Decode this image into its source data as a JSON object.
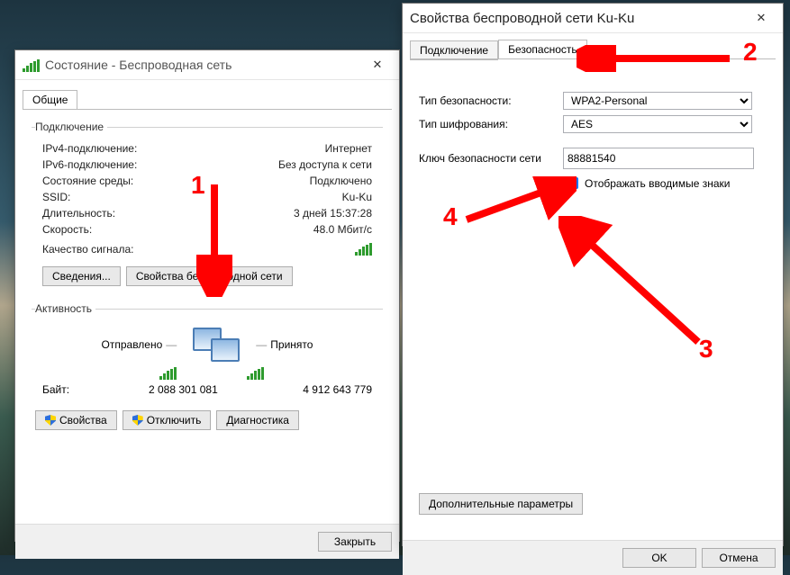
{
  "leftWindow": {
    "title": "Состояние - Беспроводная сеть",
    "tabs": {
      "general": "Общие"
    },
    "connection": {
      "legend": "Подключение",
      "ipv4_label": "IPv4-подключение:",
      "ipv4_value": "Интернет",
      "ipv6_label": "IPv6-подключение:",
      "ipv6_value": "Без доступа к сети",
      "media_label": "Состояние среды:",
      "media_value": "Подключено",
      "ssid_label": "SSID:",
      "ssid_value": "Ku-Ku",
      "duration_label": "Длительность:",
      "duration_value": "3 дней 15:37:28",
      "speed_label": "Скорость:",
      "speed_value": "48.0 Мбит/с",
      "signal_label": "Качество сигнала:",
      "details_btn": "Сведения...",
      "wprops_btn": "Свойства беспроводной сети"
    },
    "activity": {
      "legend": "Активность",
      "sent": "Отправлено",
      "received": "Принято",
      "bytes_label": "Байт:",
      "bytes_sent": "2 088 301 081",
      "bytes_received": "4 912 643 779"
    },
    "buttons": {
      "properties": "Свойства",
      "disable": "Отключить",
      "diagnose": "Диагностика",
      "close": "Закрыть"
    }
  },
  "rightWindow": {
    "title": "Свойства беспроводной сети Ku-Ku",
    "tabs": {
      "connection": "Подключение",
      "security": "Безопасность"
    },
    "sectype_label": "Тип безопасности:",
    "sectype_value": "WPA2-Personal",
    "enctype_label": "Тип шифрования:",
    "enctype_value": "AES",
    "key_label": "Ключ безопасности сети",
    "key_value": "88881540",
    "showchars_label": "Отображать вводимые знаки",
    "advanced_btn": "Дополнительные параметры",
    "ok": "OK",
    "cancel": "Отмена"
  },
  "annotations": {
    "n1": "1",
    "n2": "2",
    "n3": "3",
    "n4": "4"
  }
}
